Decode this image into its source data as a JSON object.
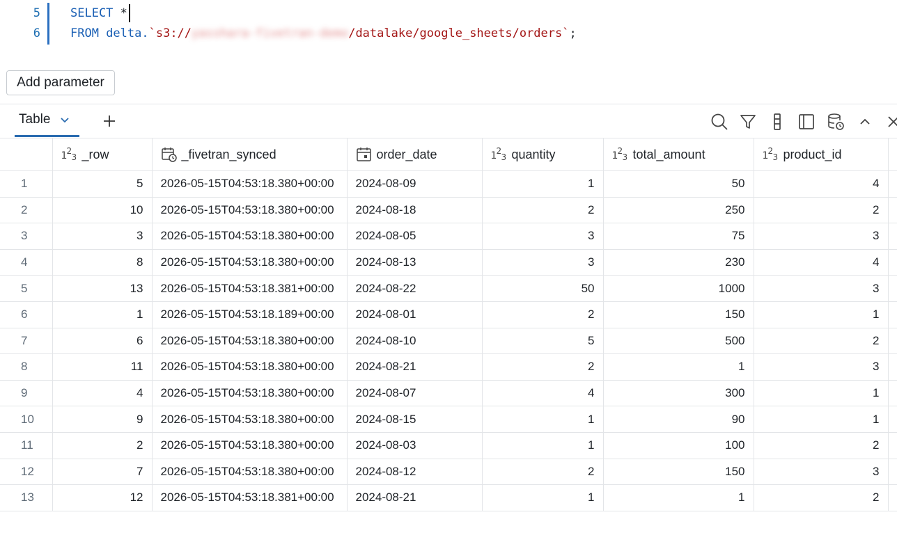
{
  "editor": {
    "lines": [
      {
        "number": "5",
        "keyword": "SELECT",
        "rest": " *"
      },
      {
        "number": "6",
        "keyword": "FROM",
        "obj": " delta.",
        "path_prefix": "`s3://",
        "path_blurred": "yasshara-fivetran-demo",
        "path_suffix": "/datalake/google_sheets/orders`",
        "end": ";"
      }
    ]
  },
  "add_parameter_label": "Add parameter",
  "toolbar": {
    "tab_label": "Table",
    "icons": [
      "search-icon",
      "filter-icon",
      "column-options-icon",
      "sidebar-panel-icon",
      "data-refresh-icon",
      "collapse-icon",
      "close-icon"
    ]
  },
  "table": {
    "columns": [
      {
        "name": "",
        "type": "index"
      },
      {
        "name": "_row",
        "type": "number"
      },
      {
        "name": "_fivetran_synced",
        "type": "timestamp"
      },
      {
        "name": "order_date",
        "type": "date"
      },
      {
        "name": "quantity",
        "type": "number"
      },
      {
        "name": "total_amount",
        "type": "number"
      },
      {
        "name": "product_id",
        "type": "number"
      }
    ],
    "rows": [
      [
        "1",
        "5",
        "2026-05-15T04:53:18.380+00:00",
        "2024-08-09",
        "1",
        "50",
        "4"
      ],
      [
        "2",
        "10",
        "2026-05-15T04:53:18.380+00:00",
        "2024-08-18",
        "2",
        "250",
        "2"
      ],
      [
        "3",
        "3",
        "2026-05-15T04:53:18.380+00:00",
        "2024-08-05",
        "3",
        "75",
        "3"
      ],
      [
        "4",
        "8",
        "2026-05-15T04:53:18.380+00:00",
        "2024-08-13",
        "3",
        "230",
        "4"
      ],
      [
        "5",
        "13",
        "2026-05-15T04:53:18.381+00:00",
        "2024-08-22",
        "50",
        "1000",
        "3"
      ],
      [
        "6",
        "1",
        "2026-05-15T04:53:18.189+00:00",
        "2024-08-01",
        "2",
        "150",
        "1"
      ],
      [
        "7",
        "6",
        "2026-05-15T04:53:18.380+00:00",
        "2024-08-10",
        "5",
        "500",
        "2"
      ],
      [
        "8",
        "11",
        "2026-05-15T04:53:18.380+00:00",
        "2024-08-21",
        "2",
        "1",
        "3"
      ],
      [
        "9",
        "4",
        "2026-05-15T04:53:18.380+00:00",
        "2024-08-07",
        "4",
        "300",
        "1"
      ],
      [
        "10",
        "9",
        "2026-05-15T04:53:18.380+00:00",
        "2024-08-15",
        "1",
        "90",
        "1"
      ],
      [
        "11",
        "2",
        "2026-05-15T04:53:18.380+00:00",
        "2024-08-03",
        "1",
        "100",
        "2"
      ],
      [
        "12",
        "7",
        "2026-05-15T04:53:18.380+00:00",
        "2024-08-12",
        "2",
        "150",
        "3"
      ],
      [
        "13",
        "12",
        "2026-05-15T04:53:18.381+00:00",
        "2024-08-21",
        "1",
        "1",
        "2"
      ]
    ]
  }
}
